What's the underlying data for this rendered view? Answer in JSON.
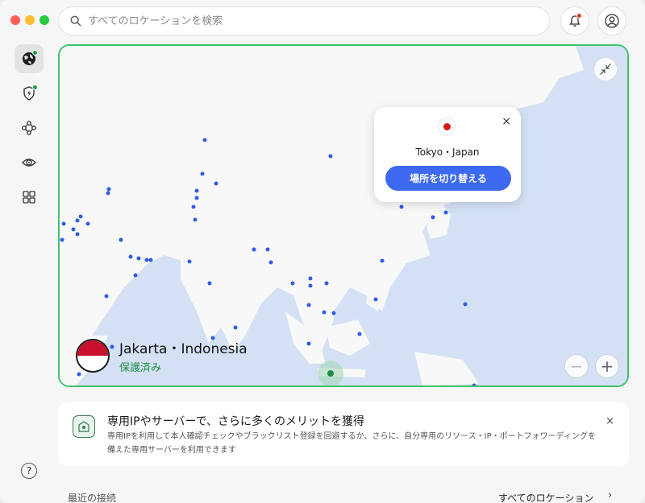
{
  "window": {
    "controls": [
      "close",
      "minimize",
      "maximize"
    ]
  },
  "search": {
    "placeholder": "すべてのロケーションを検索",
    "icon": "search-icon"
  },
  "header": {
    "notification_icon": "bell-icon",
    "account_icon": "user-icon",
    "notification_badge_color": "#e0302c"
  },
  "sidebar": {
    "items": [
      {
        "icon": "globe-icon",
        "active": true,
        "badge": true
      },
      {
        "icon": "shield-bolt-icon",
        "active": false,
        "badge": true
      },
      {
        "icon": "nodes-icon",
        "active": false,
        "badge": false
      },
      {
        "icon": "eye-target-icon",
        "active": false,
        "badge": false
      },
      {
        "icon": "grid-icon",
        "active": false,
        "badge": false
      }
    ],
    "help_label": "?"
  },
  "map": {
    "border_color": "#3ec46d",
    "popup": {
      "title": "Tokyo・Japan",
      "button": "場所を切り替える",
      "close": "×",
      "button_color": "#3d69f0"
    },
    "current": {
      "name": "Jakarta・Indonesia",
      "status": "保護済み",
      "status_color": "#1e8e45"
    },
    "zoom_out": "−",
    "zoom_in": "+"
  },
  "promo": {
    "title": "専用IPやサーバーで、さらに多くのメリットを獲得",
    "body": "専用IPを利用して本人確認チェックやブラックリスト登録を回避するか、さらに、自分専用のリソース・IP・ポートフォワーディングを備えた専用サーバーを利用できます",
    "close": "×"
  },
  "footer": {
    "recent": "最近の接続",
    "all_locations": "すべてのロケーション",
    "chevron": "›"
  }
}
